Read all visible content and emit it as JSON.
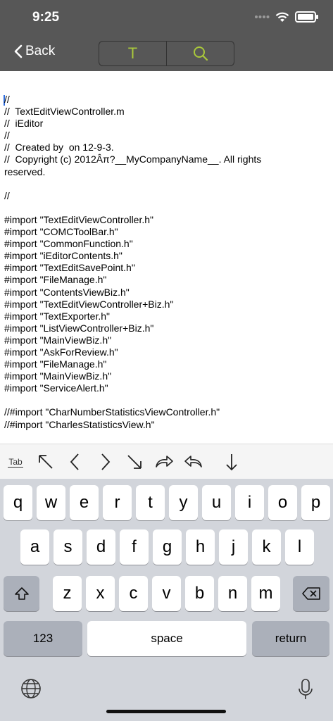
{
  "status_bar": {
    "time": "9:25"
  },
  "nav": {
    "back_label": "Back",
    "segment_text_label": "T",
    "accent_color": "#a9c83b",
    "bar_color": "#575757"
  },
  "editor": {
    "lines": [
      "//",
      "//  TextEditViewController.m",
      "//  iEditor",
      "//",
      "//  Created by  on 12-9-3.",
      "//  Copyright (c) 2012Âπ?__MyCompanyName__. All rights reserved.",
      "",
      "//",
      "",
      "#import \"TextEditViewController.h\"",
      "#import \"COMCToolBar.h\"",
      "#import \"CommonFunction.h\"",
      "#import \"iEditorContents.h\"",
      "#import \"TextEditSavePoint.h\"",
      "#import \"FileManage.h\"",
      "#import \"ContentsViewBiz.h\"",
      "#import \"TextEditViewController+Biz.h\"",
      "#import \"TextExporter.h\"",
      "#import \"ListViewController+Biz.h\"",
      "#import \"MainViewBiz.h\"",
      "#import \"AskForReview.h\"",
      "#import \"FileManage.h\"",
      "#import \"MainViewBiz.h\"",
      "#import \"ServiceAlert.h\"",
      "",
      "//#import \"CharNumberStatisticsViewController.h\"",
      "//#import \"CharlesStatisticsView.h\""
    ]
  },
  "accessory": {
    "tab_label": "Tab"
  },
  "keyboard": {
    "row1": [
      "q",
      "w",
      "e",
      "r",
      "t",
      "y",
      "u",
      "i",
      "o",
      "p"
    ],
    "row2": [
      "a",
      "s",
      "d",
      "f",
      "g",
      "h",
      "j",
      "k",
      "l"
    ],
    "row3": [
      "z",
      "x",
      "c",
      "v",
      "b",
      "n",
      "m"
    ],
    "numbers_label": "123",
    "space_label": "space",
    "return_label": "return"
  }
}
